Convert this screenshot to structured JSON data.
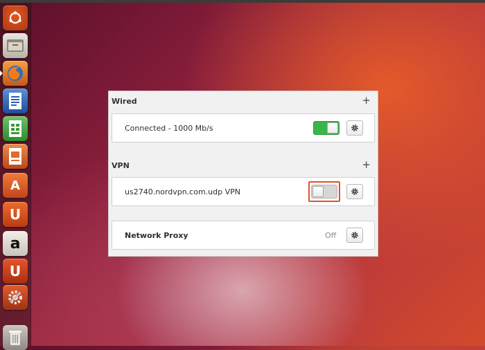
{
  "panel": {
    "wired": {
      "title": "Wired",
      "add_icon": "+",
      "connection": {
        "label": "Connected - 1000 Mb/s",
        "enabled": true
      }
    },
    "vpn": {
      "title": "VPN",
      "add_icon": "+",
      "connection": {
        "label": "us2740.nordvpn.com.udp VPN",
        "enabled": false
      }
    },
    "proxy": {
      "label": "Network Proxy",
      "status": "Off"
    }
  },
  "launcher": {
    "items": [
      "ubuntu-dash-icon",
      "files-icon",
      "firefox-icon",
      "writer-icon",
      "calc-icon",
      "impress-icon",
      "software-center-icon",
      "ubuntu-one-icon",
      "amazon-icon",
      "ubuntu-one-music-icon",
      "system-settings-icon",
      "trash-icon"
    ],
    "amazon_letter": "a",
    "u_letter": "U",
    "store_letter": "A"
  },
  "colors": {
    "toggle_on": "#3bb54a",
    "toggle_off": "#d6d6d6",
    "highlight": "#e0522a"
  }
}
